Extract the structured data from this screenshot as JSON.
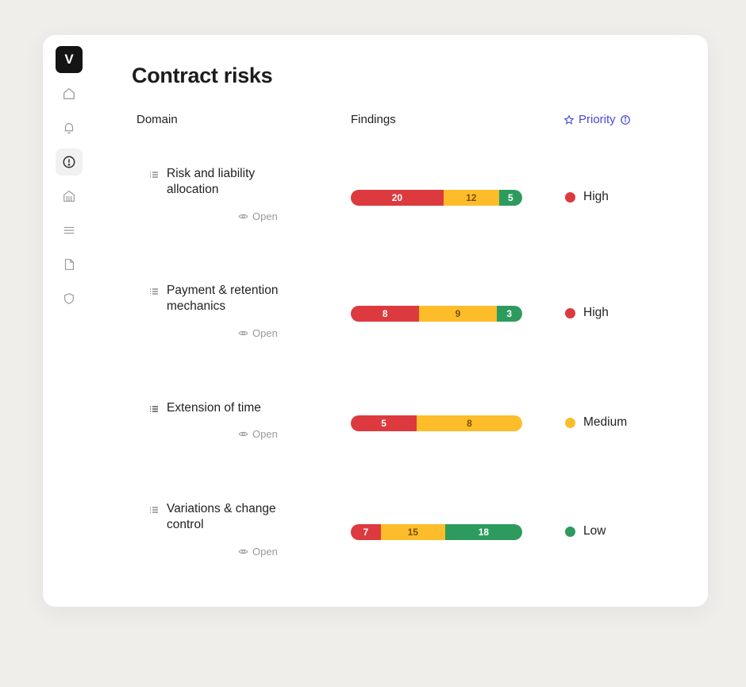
{
  "app": {
    "logo_letter": "V"
  },
  "sidebar": {
    "items": [
      {
        "name": "home",
        "icon": "home-icon",
        "active": false
      },
      {
        "name": "notifications",
        "icon": "bell-icon",
        "active": false
      },
      {
        "name": "risks",
        "icon": "alert-circle-icon",
        "active": true
      },
      {
        "name": "bank",
        "icon": "building-icon",
        "active": false
      },
      {
        "name": "menu",
        "icon": "lines-icon",
        "active": false
      },
      {
        "name": "documents",
        "icon": "file-icon",
        "active": false
      },
      {
        "name": "security",
        "icon": "shield-icon",
        "active": false
      }
    ]
  },
  "page": {
    "title": "Contract risks"
  },
  "columns": {
    "domain": "Domain",
    "findings": "Findings",
    "priority": "Priority"
  },
  "colors": {
    "red": "#dc3a3f",
    "amber": "#fdbd2a",
    "green": "#2d9b5e",
    "accent": "#4a4ad6"
  },
  "rows": [
    {
      "domain": "Risk and liability allocation",
      "open_label": "Open",
      "findings": {
        "red": 20,
        "amber": 12,
        "green": 5
      },
      "priority": "High",
      "priority_level": "high"
    },
    {
      "domain": "Payment & retention mechanics",
      "open_label": "Open",
      "findings": {
        "red": 8,
        "amber": 9,
        "green": 3
      },
      "priority": "High",
      "priority_level": "high"
    },
    {
      "domain": "Extension of time",
      "open_label": "Open",
      "findings": {
        "red": 5,
        "amber": 8,
        "green": 0
      },
      "priority": "Medium",
      "priority_level": "medium"
    },
    {
      "domain": "Variations & change control",
      "open_label": "Open",
      "findings": {
        "red": 7,
        "amber": 15,
        "green": 18
      },
      "priority": "Low",
      "priority_level": "low"
    }
  ]
}
